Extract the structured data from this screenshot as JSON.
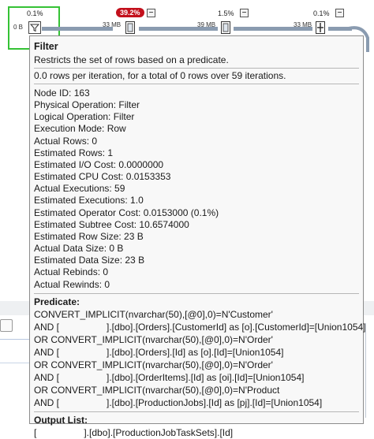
{
  "plan": {
    "filter_node": {
      "cost": "0.1%",
      "rows_label": "0 B"
    },
    "nodes": [
      {
        "cost": "39.2%",
        "highlight": true,
        "arrow_label": "33 MB"
      },
      {
        "cost": "1.5%",
        "highlight": false,
        "arrow_label": "39 MB"
      },
      {
        "cost": "0.1%",
        "highlight": false,
        "arrow_label": "33 MB"
      }
    ],
    "collapse_symbol": "−"
  },
  "tooltip": {
    "title": "Filter",
    "description": "Restricts the set of rows based on a predicate.",
    "rows_summary": "0.0 rows per iteration, for a total of 0 rows over 59 iterations.",
    "properties": [
      "Node ID:  163",
      "Physical Operation:  Filter",
      "Logical Operation:  Filter",
      "Execution Mode:  Row",
      "Actual Rows:  0",
      "Estimated Rows:  1",
      "Estimated I/O Cost:  0.0000000",
      "Estimated CPU Cost:  0.0153353",
      "Actual Executions:  59",
      "Estimated Executions:  1.0",
      "Estimated Operator Cost:  0.0153000 (0.1%)",
      "Estimated Subtree Cost:  10.6574000",
      "Estimated Row Size:  23 B",
      "Actual Data Size:  0 B",
      "Estimated Data Size:  23 B",
      "Actual Rebinds:  0",
      "Actual Rewinds:  0"
    ],
    "predicate_header": "Predicate:",
    "predicate_lines": [
      "CONVERT_IMPLICIT(nvarchar(50),[@0],0)=N'Customer'",
      "AND [",
      "].[dbo].[Orders].[CustomerId] as [o].[CustomerId]=[Union1054]",
      "OR CONVERT_IMPLICIT(nvarchar(50),[@0],0)=N'Order'",
      "AND [",
      "].[dbo].[Orders].[Id] as [o].[Id]=[Union1054]",
      "OR CONVERT_IMPLICIT(nvarchar(50),[@0],0)=N'Order'",
      "AND [",
      "].[dbo].[OrderItems].[Id] as [oi].[Id]=[Union1054]",
      "OR CONVERT_IMPLICIT(nvarchar(50),[@0],0)=N'Product",
      "AND [",
      "].[dbo].[ProductionJobs].[Id] as [pj].[Id]=[Union1054]"
    ],
    "output_header": "Output List:",
    "output_lines": [
      "[",
      "].[dbo].[ProductionJobTaskSets].[Id]"
    ]
  }
}
